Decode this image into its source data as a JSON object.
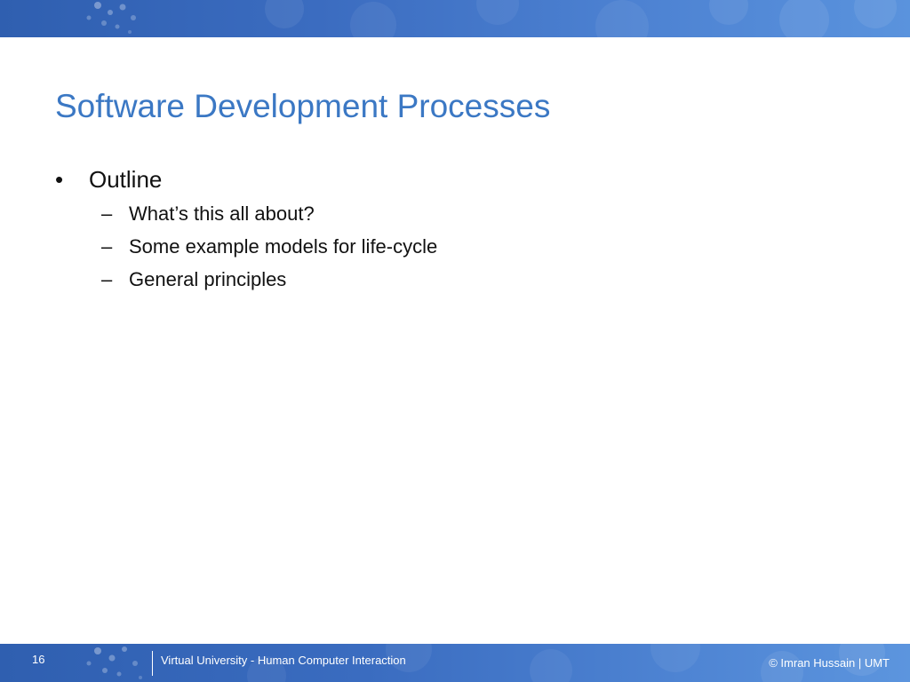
{
  "slide": {
    "title": "Software Development Processes",
    "outline": {
      "label": "Outline",
      "items": [
        "What’s this all about?",
        "Some example models for life-cycle",
        "General principles"
      ]
    }
  },
  "footer": {
    "page_number": "16",
    "course": "Virtual University - Human Computer Interaction",
    "copyright": "© Imran Hussain | UMT"
  },
  "colors": {
    "title": "#3b78c4",
    "band": "#3b6cc0",
    "text": "#111111"
  },
  "icons": {
    "bullet": "bullet-dot-icon",
    "sub_bullet": "en-dash-icon"
  }
}
